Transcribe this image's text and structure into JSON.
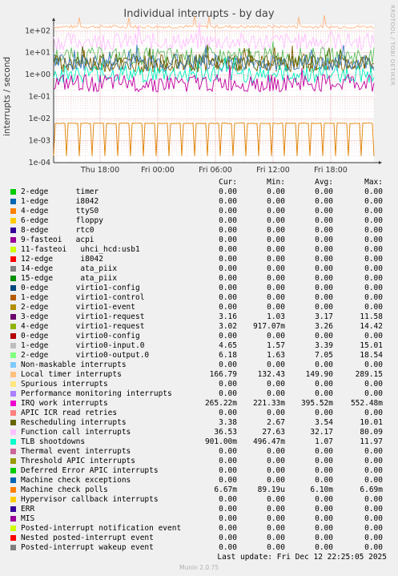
{
  "title": "Individual interrupts - by day",
  "side_label": "RRDTOOL / TOBI OETIKER",
  "footer": "Munin 2.0.75",
  "last_update": "Last update: Fri Dec 12 22:25:05 2025",
  "columns": [
    "Cur:",
    "Min:",
    "Avg:",
    "Max:"
  ],
  "chart_data": {
    "type": "line",
    "title": "Individual interrupts - by day",
    "ylabel": "interrupts / second",
    "yscale": "log",
    "ylim": [
      0.0001,
      200
    ],
    "yticks": [
      "1e+02",
      "1e+01",
      "1e+00",
      "1e-01",
      "1e-02",
      "1e-03",
      "1e-04"
    ],
    "xticks": [
      "Thu 18:00",
      "Fri 00:00",
      "Fri 06:00",
      "Fri 12:00",
      "Fri 18:00"
    ],
    "grid": true,
    "series": [
      {
        "name": "Local timer interrupts",
        "color": "#ffb380",
        "level": 150
      },
      {
        "name": "Function call interrupts",
        "color": "#ffc0ff",
        "level": 32
      },
      {
        "name": "virtio0-output.0",
        "color": "#60c060",
        "level": 7
      },
      {
        "name": "Rescheduling interrupts",
        "color": "#506000",
        "level": 3.5
      },
      {
        "name": "virtio1-request",
        "color": "#806000",
        "level": 3.2
      },
      {
        "name": "virtio0-input.0",
        "color": "#4080c0",
        "level": 3.4
      },
      {
        "name": "TLB shootdowns",
        "color": "#00f0c0",
        "level": 1.07
      },
      {
        "name": "IRQ work interrupts",
        "color": "#c000a0",
        "level": 0.4
      },
      {
        "name": "Machine check polls",
        "color": "#e08000",
        "level": 0.0061
      }
    ]
  },
  "legend": [
    {
      "color": "#00cc00",
      "label": "2-edge      timer",
      "cur": "0.00",
      "min": "0.00",
      "avg": "0.00",
      "max": "0.00"
    },
    {
      "color": "#0066b3",
      "label": "1-edge      i8042",
      "cur": "0.00",
      "min": "0.00",
      "avg": "0.00",
      "max": "0.00"
    },
    {
      "color": "#ff8000",
      "label": "4-edge      ttyS0",
      "cur": "0.00",
      "min": "0.00",
      "avg": "0.00",
      "max": "0.00"
    },
    {
      "color": "#ffcc00",
      "label": "6-edge      floppy",
      "cur": "0.00",
      "min": "0.00",
      "avg": "0.00",
      "max": "0.00"
    },
    {
      "color": "#330099",
      "label": "8-edge      rtc0",
      "cur": "0.00",
      "min": "0.00",
      "avg": "0.00",
      "max": "0.00"
    },
    {
      "color": "#990099",
      "label": "9-fasteoi   acpi",
      "cur": "0.00",
      "min": "0.00",
      "avg": "0.00",
      "max": "0.00"
    },
    {
      "color": "#ccff00",
      "label": "11-fasteoi   uhci_hcd:usb1",
      "cur": "0.00",
      "min": "0.00",
      "avg": "0.00",
      "max": "0.00"
    },
    {
      "color": "#ff0000",
      "label": "12-edge      i8042",
      "cur": "0.00",
      "min": "0.00",
      "avg": "0.00",
      "max": "0.00"
    },
    {
      "color": "#808080",
      "label": "14-edge      ata_piix",
      "cur": "0.00",
      "min": "0.00",
      "avg": "0.00",
      "max": "0.00"
    },
    {
      "color": "#008f00",
      "label": "15-edge      ata_piix",
      "cur": "0.00",
      "min": "0.00",
      "avg": "0.00",
      "max": "0.00"
    },
    {
      "color": "#00487d",
      "label": "0-edge      virtio1-config",
      "cur": "0.00",
      "min": "0.00",
      "avg": "0.00",
      "max": "0.00"
    },
    {
      "color": "#b35a00",
      "label": "1-edge      virtio1-control",
      "cur": "0.00",
      "min": "0.00",
      "avg": "0.00",
      "max": "0.00"
    },
    {
      "color": "#b38f00",
      "label": "2-edge      virtio1-event",
      "cur": "0.00",
      "min": "0.00",
      "avg": "0.00",
      "max": "0.00"
    },
    {
      "color": "#6b006b",
      "label": "3-edge      virtio1-request",
      "cur": "3.16",
      "min": "1.03",
      "avg": "3.17",
      "max": "11.58"
    },
    {
      "color": "#8fb300",
      "label": "4-edge      virtio1-request",
      "cur": "3.02",
      "min": "917.07m",
      "avg": "3.26",
      "max": "14.42"
    },
    {
      "color": "#b30000",
      "label": "0-edge      virtio0-config",
      "cur": "0.00",
      "min": "0.00",
      "avg": "0.00",
      "max": "0.00"
    },
    {
      "color": "#bebebe",
      "label": "1-edge      virtio0-input.0",
      "cur": "4.65",
      "min": "1.57",
      "avg": "3.39",
      "max": "15.01"
    },
    {
      "color": "#80ff80",
      "label": "2-edge      virtio0-output.0",
      "cur": "6.18",
      "min": "1.63",
      "avg": "7.05",
      "max": "18.54"
    },
    {
      "color": "#80c9ff",
      "label": "Non-maskable interrupts",
      "cur": "0.00",
      "min": "0.00",
      "avg": "0.00",
      "max": "0.00"
    },
    {
      "color": "#ffc080",
      "label": "Local timer interrupts",
      "cur": "166.79",
      "min": "132.43",
      "avg": "149.90",
      "max": "289.15"
    },
    {
      "color": "#ffe680",
      "label": "Spurious interrupts",
      "cur": "0.00",
      "min": "0.00",
      "avg": "0.00",
      "max": "0.00"
    },
    {
      "color": "#aa80ff",
      "label": "Performance monitoring interrupts",
      "cur": "0.00",
      "min": "0.00",
      "avg": "0.00",
      "max": "0.00"
    },
    {
      "color": "#ee00cc",
      "label": "IRQ work interrupts",
      "cur": "265.22m",
      "min": "221.33m",
      "avg": "395.52m",
      "max": "552.48m"
    },
    {
      "color": "#ff8080",
      "label": "APIC ICR read retries",
      "cur": "0.00",
      "min": "0.00",
      "avg": "0.00",
      "max": "0.00"
    },
    {
      "color": "#666600",
      "label": "Rescheduling interrupts",
      "cur": "3.38",
      "min": "2.67",
      "avg": "3.54",
      "max": "10.01"
    },
    {
      "color": "#ffbfff",
      "label": "Function call interrupts",
      "cur": "36.53",
      "min": "27.63",
      "avg": "32.17",
      "max": "80.09"
    },
    {
      "color": "#00ffcc",
      "label": "TLB shootdowns",
      "cur": "901.00m",
      "min": "496.47m",
      "avg": "1.07",
      "max": "11.97"
    },
    {
      "color": "#cc6699",
      "label": "Thermal event interrupts",
      "cur": "0.00",
      "min": "0.00",
      "avg": "0.00",
      "max": "0.00"
    },
    {
      "color": "#999900",
      "label": "Threshold APIC interrupts",
      "cur": "0.00",
      "min": "0.00",
      "avg": "0.00",
      "max": "0.00"
    },
    {
      "color": "#00cc00",
      "label": "Deferred Error APIC interrupts",
      "cur": "0.00",
      "min": "0.00",
      "avg": "0.00",
      "max": "0.00"
    },
    {
      "color": "#0066b3",
      "label": "Machine check exceptions",
      "cur": "0.00",
      "min": "0.00",
      "avg": "0.00",
      "max": "0.00"
    },
    {
      "color": "#ff8000",
      "label": "Machine check polls",
      "cur": "6.67m",
      "min": "89.19u",
      "avg": "6.10m",
      "max": "6.69m"
    },
    {
      "color": "#ffcc00",
      "label": "Hypervisor callback interrupts",
      "cur": "0.00",
      "min": "0.00",
      "avg": "0.00",
      "max": "0.00"
    },
    {
      "color": "#330099",
      "label": "ERR",
      "cur": "0.00",
      "min": "0.00",
      "avg": "0.00",
      "max": "0.00"
    },
    {
      "color": "#990099",
      "label": "MIS",
      "cur": "0.00",
      "min": "0.00",
      "avg": "0.00",
      "max": "0.00"
    },
    {
      "color": "#ccff00",
      "label": "Posted-interrupt notification event",
      "cur": "0.00",
      "min": "0.00",
      "avg": "0.00",
      "max": "0.00"
    },
    {
      "color": "#ff0000",
      "label": "Nested posted-interrupt event",
      "cur": "0.00",
      "min": "0.00",
      "avg": "0.00",
      "max": "0.00"
    },
    {
      "color": "#808080",
      "label": "Posted-interrupt wakeup event",
      "cur": "0.00",
      "min": "0.00",
      "avg": "0.00",
      "max": "0.00"
    }
  ]
}
